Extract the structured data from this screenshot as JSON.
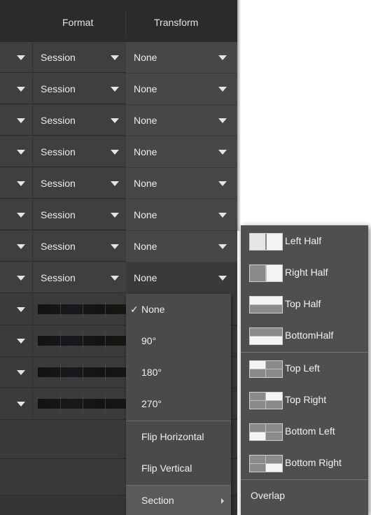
{
  "header": {
    "format_label": "Format",
    "transform_label": "Transform"
  },
  "rows": [
    {
      "format": "Session",
      "transform": "None"
    },
    {
      "format": "Session",
      "transform": "None"
    },
    {
      "format": "Session",
      "transform": "None"
    },
    {
      "format": "Session",
      "transform": "None"
    },
    {
      "format": "Session",
      "transform": "None"
    },
    {
      "format": "Session",
      "transform": "None"
    },
    {
      "format": "Session",
      "transform": "None"
    },
    {
      "format": "Session",
      "transform": "None"
    }
  ],
  "transform_menu": {
    "items": [
      {
        "label": "None",
        "checked": true,
        "check": "✓"
      },
      {
        "label": "90°"
      },
      {
        "label": "180°"
      },
      {
        "label": "270°"
      },
      {
        "label": "Flip Horizontal"
      },
      {
        "label": "Flip Vertical"
      },
      {
        "label": "Section",
        "has_submenu": true
      }
    ]
  },
  "section_submenu": {
    "items": [
      {
        "label": "Left Half",
        "icon": "left-half-icon"
      },
      {
        "label": "Right Half",
        "icon": "right-half-icon"
      },
      {
        "label": "Top Half",
        "icon": "top-half-icon"
      },
      {
        "label": "BottomHalf",
        "icon": "bottom-half-icon"
      },
      {
        "label": "Top Left",
        "icon": "top-left-quadrant-icon"
      },
      {
        "label": "Top Right",
        "icon": "top-right-quadrant-icon"
      },
      {
        "label": "Bottom Left",
        "icon": "bottom-left-quadrant-icon"
      },
      {
        "label": "Bottom Right",
        "icon": "bottom-right-quadrant-icon"
      },
      {
        "label": "Overlap"
      }
    ]
  },
  "colors": {
    "panel_bg": "#3c3c3c",
    "header_bg": "#2b2b2b",
    "menu_bg": "#4a4a4a",
    "submenu_bg": "#4f4f4f",
    "icon_fill": "#8a8a8a",
    "icon_bg": "#f4f4f4"
  }
}
